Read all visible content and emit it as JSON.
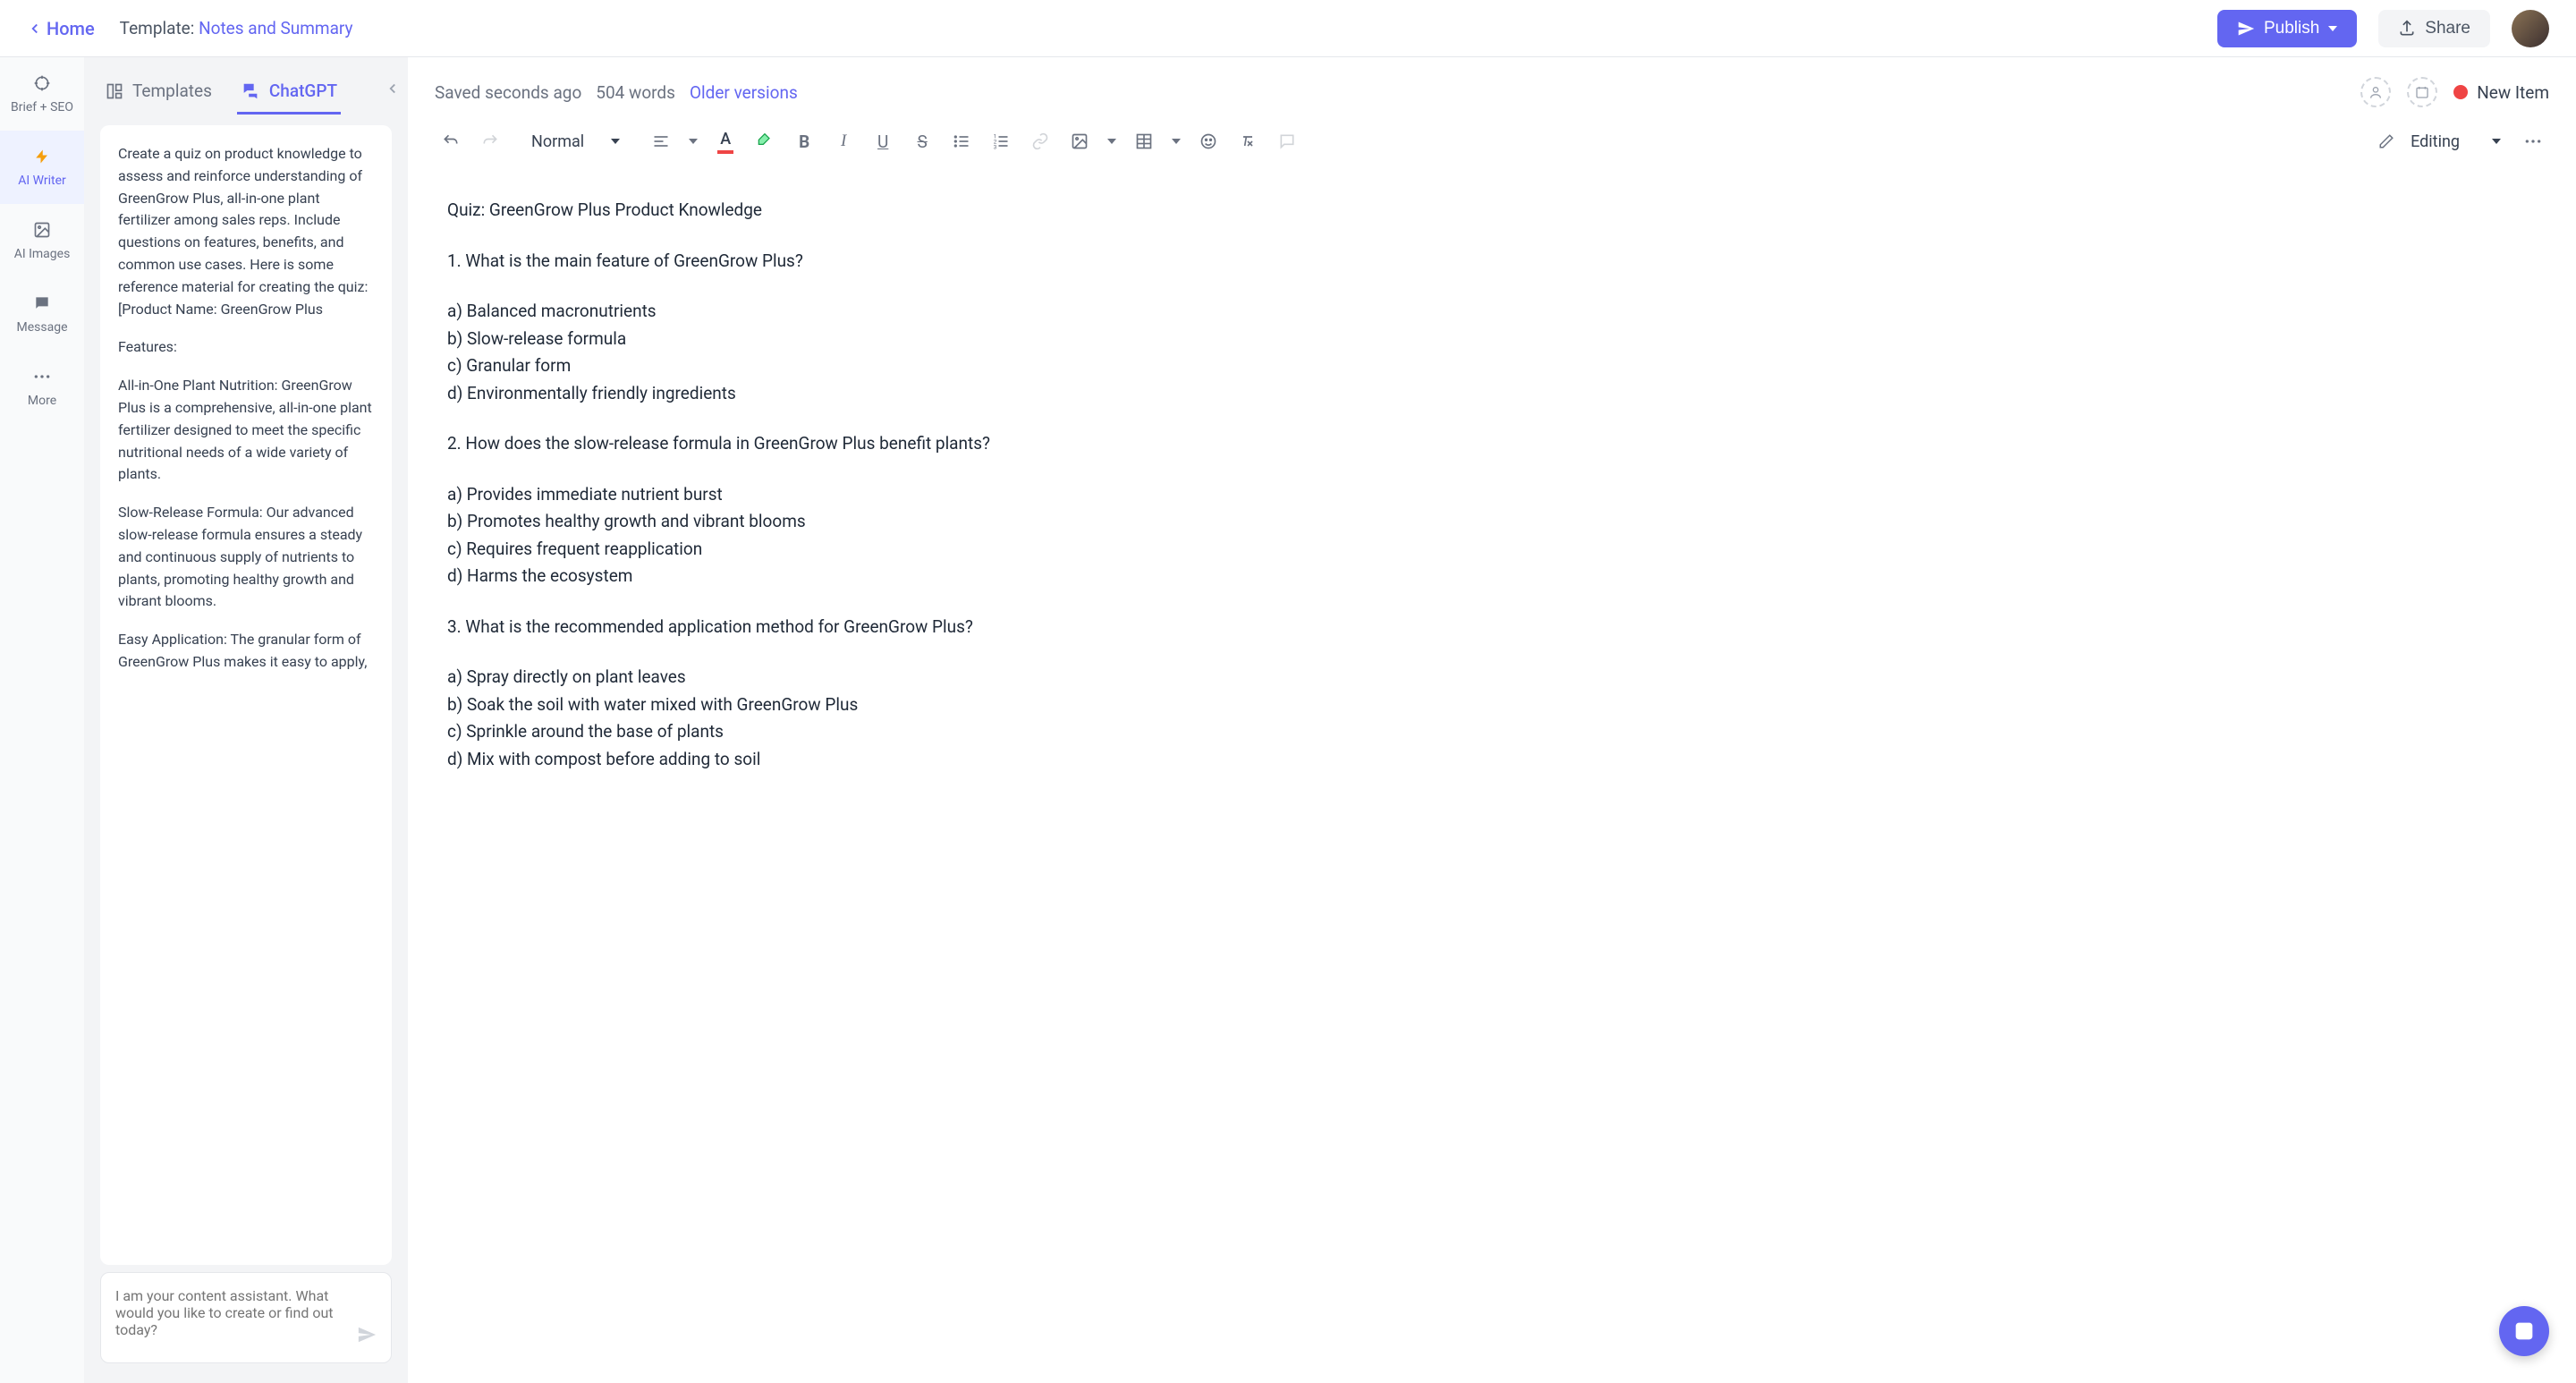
{
  "header": {
    "home": "Home",
    "template_prefix": "Template: ",
    "template_name": "Notes and Summary",
    "publish": "Publish",
    "share": "Share"
  },
  "sidebar": {
    "items": [
      {
        "label": "Brief + SEO"
      },
      {
        "label": "AI Writer"
      },
      {
        "label": "AI Images"
      },
      {
        "label": "Message"
      },
      {
        "label": "More"
      }
    ]
  },
  "panel": {
    "tabs": {
      "templates": "Templates",
      "chatgpt": "ChatGPT"
    },
    "message": "Create a quiz on product knowledge to assess and reinforce understanding of GreenGrow Plus, all-in-one plant fertilizer among sales reps. Include questions on features, benefits, and common use cases. Here is some reference material for creating the quiz: [Product Name: GreenGrow Plus",
    "features_heading": "Features:",
    "feature1": "All-in-One Plant Nutrition: GreenGrow Plus is a comprehensive, all-in-one plant fertilizer designed to meet the specific nutritional needs of a wide variety of plants.",
    "feature2": "Slow-Release Formula: Our advanced slow-release formula ensures a steady and continuous supply of nutrients to plants, promoting healthy growth and vibrant blooms.",
    "feature3": "Easy Application: The granular form of GreenGrow Plus makes it easy to apply,",
    "input_placeholder": "I am your content assistant. What would you like to create or find out today?"
  },
  "editor_meta": {
    "saved": "Saved seconds ago",
    "words": "504 words",
    "versions": "Older versions",
    "status": "New Item"
  },
  "toolbar": {
    "style": "Normal",
    "mode": "Editing"
  },
  "document": {
    "title": "Quiz: GreenGrow Plus Product Knowledge",
    "q1": "1. What is the main feature of GreenGrow Plus?",
    "q1a": "a) Balanced macronutrients",
    "q1b": "b) Slow-release formula",
    "q1c": "c) Granular form",
    "q1d": "d) Environmentally friendly ingredients",
    "q2": "2. How does the slow-release formula in GreenGrow Plus benefit plants?",
    "q2a": "a) Provides immediate nutrient burst",
    "q2b": "b) Promotes healthy growth and vibrant blooms",
    "q2c": "c) Requires frequent reapplication",
    "q2d": "d) Harms the ecosystem",
    "q3": "3. What is the recommended application method for GreenGrow Plus?",
    "q3a": "a) Spray directly on plant leaves",
    "q3b": "b) Soak the soil with water mixed with GreenGrow Plus",
    "q3c": "c) Sprinkle around the base of plants",
    "q3d": "d) Mix with compost before adding to soil"
  }
}
